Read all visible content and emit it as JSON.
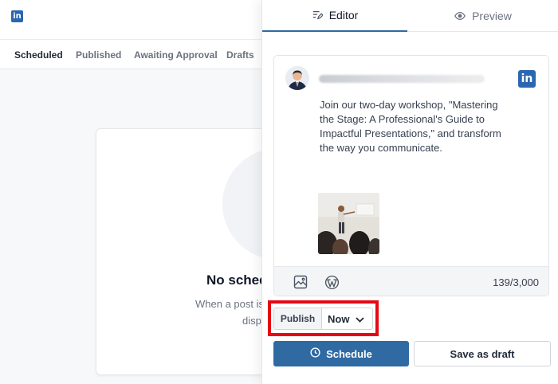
{
  "app": {
    "logo_text": "in"
  },
  "status_tabs": [
    {
      "label": "Scheduled"
    },
    {
      "label": "Published"
    },
    {
      "label": "Awaiting Approval"
    },
    {
      "label": "Drafts"
    }
  ],
  "empty_state": {
    "title": "No sched",
    "desc_line1": "When a post is",
    "desc_line2": "disp"
  },
  "panel": {
    "tabs": {
      "editor": "Editor",
      "preview": "Preview"
    },
    "post": {
      "network_logo": "in",
      "text_lines": [
        "Join our two-day workshop, \"Mastering",
        "the Stage: A Professional's Guide to",
        "Impactful Presentations,\" and transform",
        "the way you communicate."
      ],
      "char_count": "139/3,000"
    },
    "publish": {
      "label": "Publish",
      "value": "Now"
    },
    "buttons": {
      "schedule": "Schedule",
      "save_draft": "Save as draft"
    }
  },
  "colors": {
    "accent": "#2f6aa3",
    "linkedin": "#2b67b1",
    "highlight": "#e50914"
  },
  "icons": [
    "linkedin-icon",
    "edit-icon",
    "eye-icon",
    "image-icon",
    "wordpress-icon",
    "chevron-down-icon",
    "clock-icon"
  ]
}
